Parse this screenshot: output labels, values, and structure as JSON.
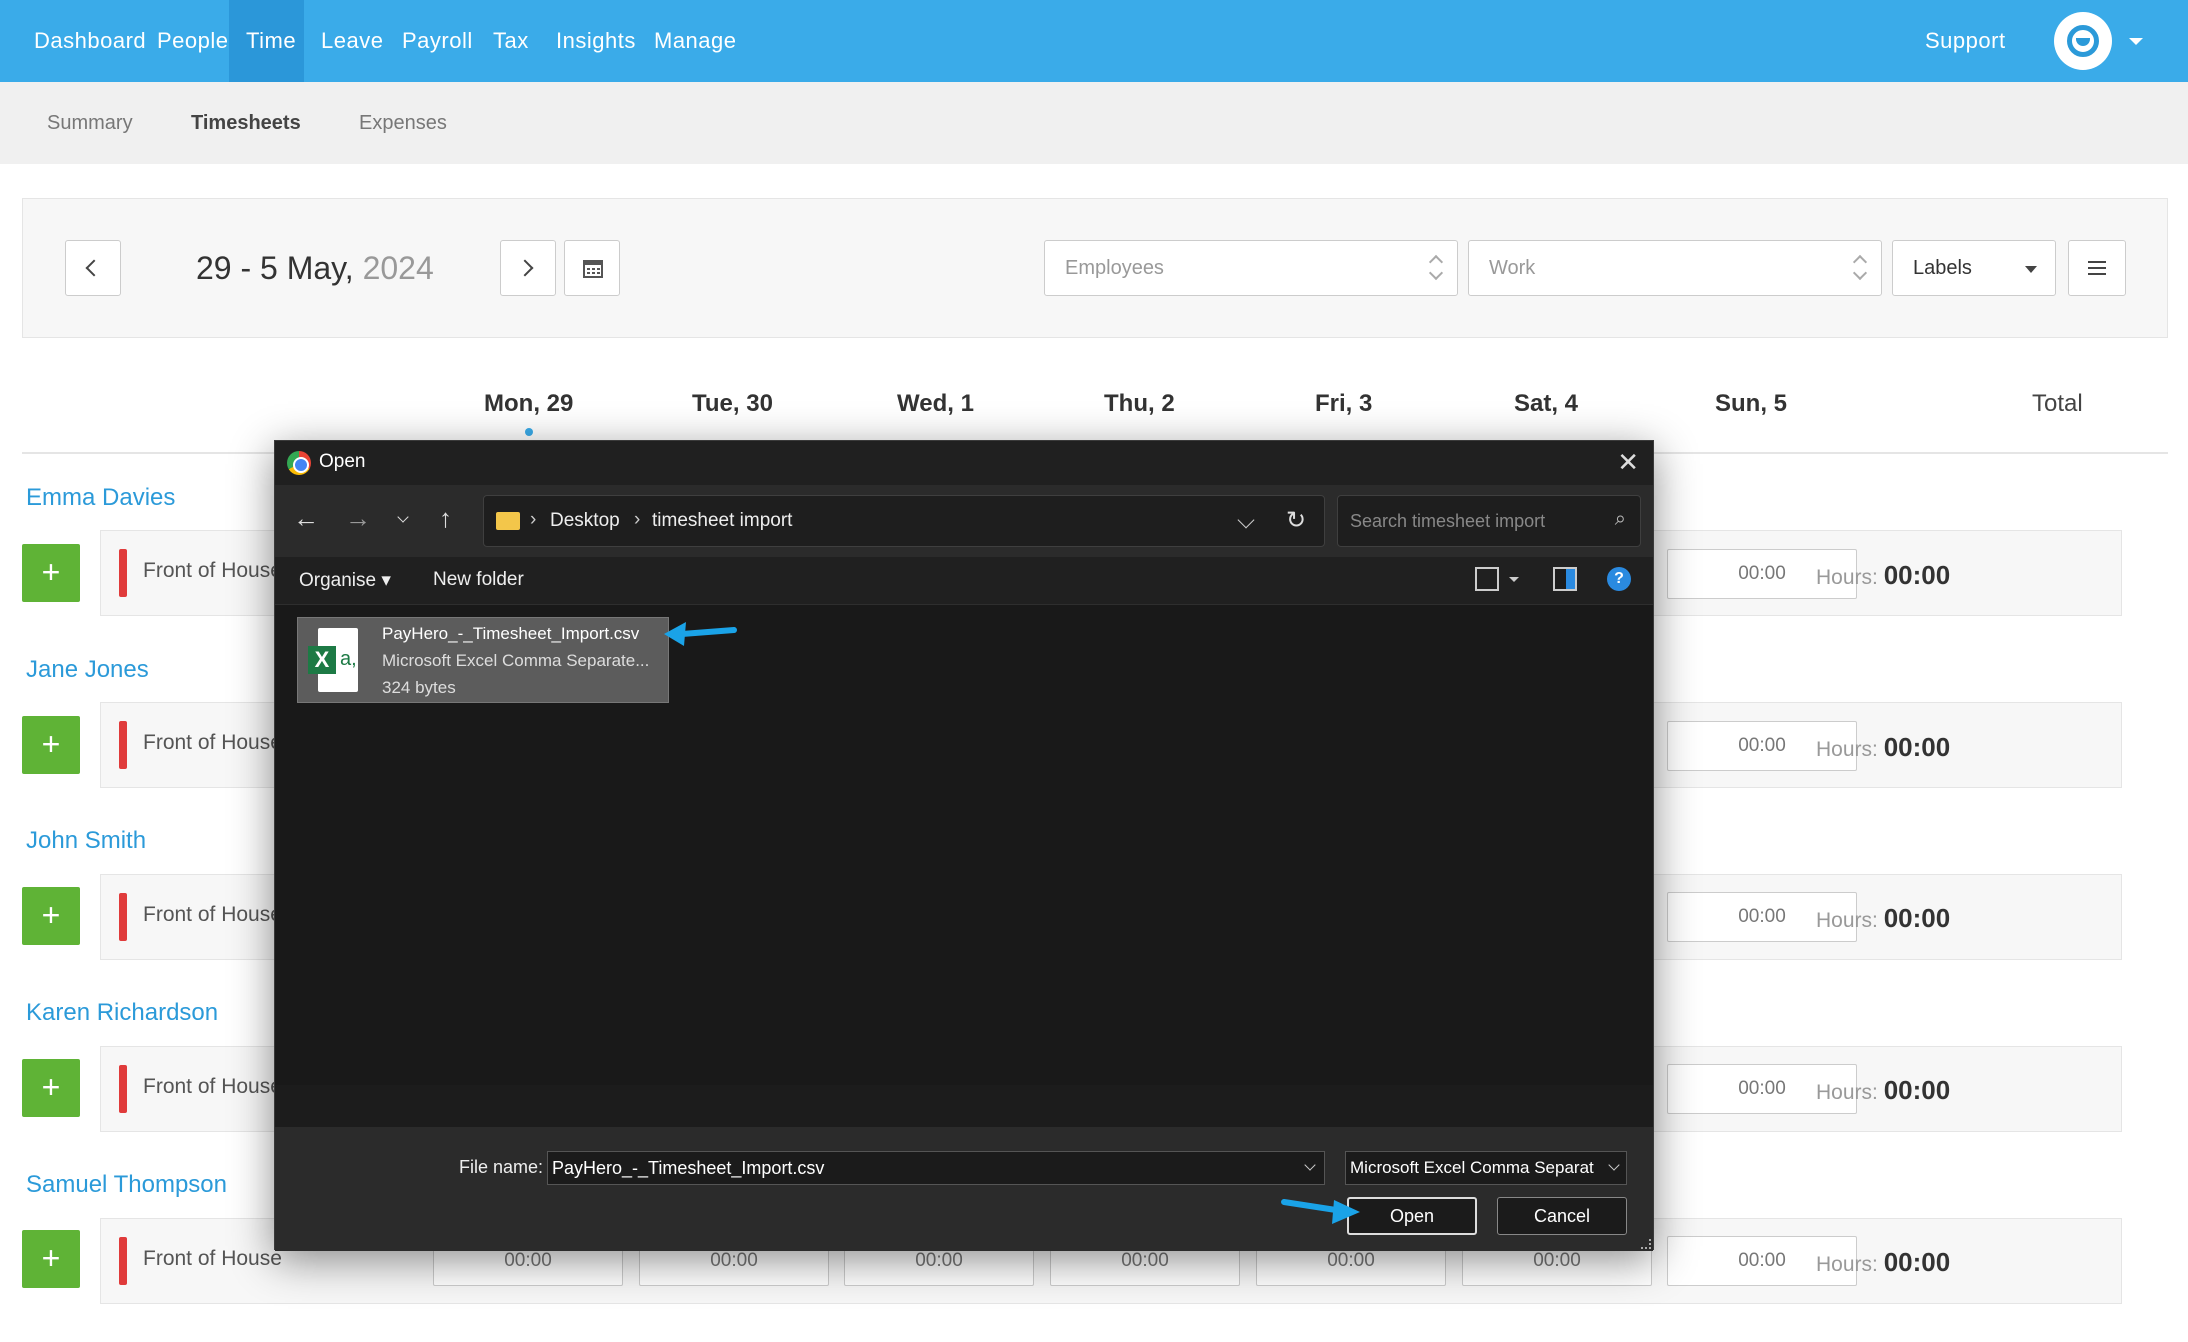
{
  "topnav": {
    "items": [
      "Dashboard",
      "People",
      "Time",
      "Leave",
      "Payroll",
      "Tax",
      "Insights",
      "Manage"
    ],
    "active": "Time",
    "support": "Support"
  },
  "subnav": {
    "items": [
      "Summary",
      "Timesheets",
      "Expenses"
    ],
    "active": "Timesheets"
  },
  "toolbar": {
    "date_range": "29 - 5 May,",
    "year": "2024",
    "employees_placeholder": "Employees",
    "work_placeholder": "Work",
    "labels": "Labels"
  },
  "days": [
    "Mon, 29",
    "Tue, 30",
    "Wed, 1",
    "Thu, 2",
    "Fri, 3",
    "Sat, 4",
    "Sun, 5"
  ],
  "total_label": "Total",
  "employees": [
    {
      "name": "Emma Davies",
      "role": "Front of House",
      "sun": "00:00",
      "hours_label": "Hours:",
      "hours": "00:00"
    },
    {
      "name": "Jane Jones",
      "role": "Front of House",
      "sun": "00:00",
      "hours_label": "Hours:",
      "hours": "00:00"
    },
    {
      "name": "John Smith",
      "role": "Front of House",
      "sun": "00:00",
      "hours_label": "Hours:",
      "hours": "00:00"
    },
    {
      "name": "Karen Richardson",
      "role": "Front of House",
      "sun": "00:00",
      "hours_label": "Hours:",
      "hours": "00:00"
    },
    {
      "name": "Samuel Thompson",
      "role": "Front of House",
      "sun": "00:00",
      "hours_label": "Hours:",
      "hours": "00:00",
      "days": [
        "00:00",
        "00:00",
        "00:00",
        "00:00",
        "00:00",
        "00:00"
      ]
    }
  ],
  "dialog": {
    "title": "Open",
    "path": [
      "Desktop",
      "timesheet import"
    ],
    "search_placeholder": "Search timesheet import",
    "organise": "Organise",
    "new_folder": "New folder",
    "help": "?",
    "file": {
      "name": "PayHero_-_Timesheet_Import.csv",
      "type": "Microsoft Excel Comma Separate...",
      "size": "324 bytes"
    },
    "file_name_label": "File name:",
    "file_name_value": "PayHero_-_Timesheet_Import.csv",
    "file_type_value": "Microsoft Excel Comma Separat",
    "open": "Open",
    "cancel": "Cancel"
  },
  "colors": {
    "brand": "#3aabe9",
    "add": "#5fb336",
    "role_bar": "#e03b3b",
    "annotation_arrow": "#1aa3e8"
  }
}
